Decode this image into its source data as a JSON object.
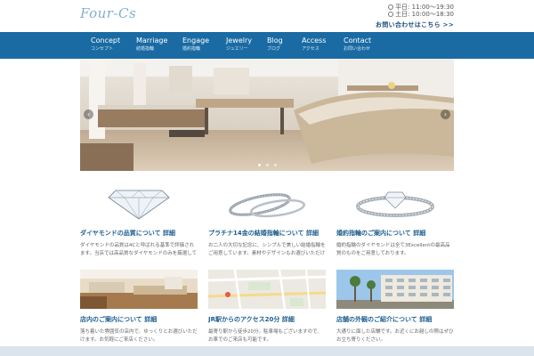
{
  "header": {
    "logo_text": "Four-Cs",
    "hours": [
      {
        "label": "平日: 11:00～19:30"
      },
      {
        "label": "土日: 10:00～18:30"
      }
    ],
    "more_link": "お問い合わせはこちら >>"
  },
  "nav": {
    "items": [
      {
        "en": "Concept",
        "jp": "コンセプト"
      },
      {
        "en": "Marriage",
        "jp": "結婚指輪"
      },
      {
        "en": "Engage",
        "jp": "婚約指輪"
      },
      {
        "en": "Jewelry",
        "jp": "ジュエリー"
      },
      {
        "en": "Blog",
        "jp": "ブログ"
      },
      {
        "en": "Access",
        "jp": "アクセス"
      },
      {
        "en": "Contact",
        "jp": "お問い合わせ"
      }
    ]
  },
  "hero": {
    "prev_label": "‹",
    "next_label": "›",
    "slide_count": 3,
    "active_slide": 1
  },
  "cards": [
    {
      "title": "ダイヤモンドの品質について 詳細",
      "desc": "ダイヤモンドの品質は4Cと呼ばれる基準で評価されます。当店では高品質なダイヤモンドのみを厳選しています。"
    },
    {
      "title": "プラチナ14金の結婚指輪について 詳細",
      "desc": "お二人の大切な記念に、シンプルで美しい結婚指輪をご用意しています。素材やデザインもお選びいただけます。"
    },
    {
      "title": "婚約指輪のご案内について 詳細",
      "desc": "婚約指輪のダイヤモンドは全て3Excellentの最高品質のものをご用意しております。"
    },
    {
      "title": "店内のご案内について 詳細",
      "desc": "落ち着いた雰囲気の店内で、ゆっくりとお選びいただけます。お気軽にご来店ください。"
    },
    {
      "title": "JR駅からのアクセス20分 詳細",
      "desc": "最寄り駅から徒歩20分。駐車場もございますので、お車でのご来店も可能です。"
    },
    {
      "title": "店舗の外観のご紹介について 詳細",
      "desc": "大通りに面した店舗です。お近くにお越しの際はぜひお立ち寄りください。"
    }
  ],
  "colors": {
    "nav_bg": "#1a6ba4",
    "card_title": "#1f5f8f",
    "logo": "#7fb0cf"
  }
}
